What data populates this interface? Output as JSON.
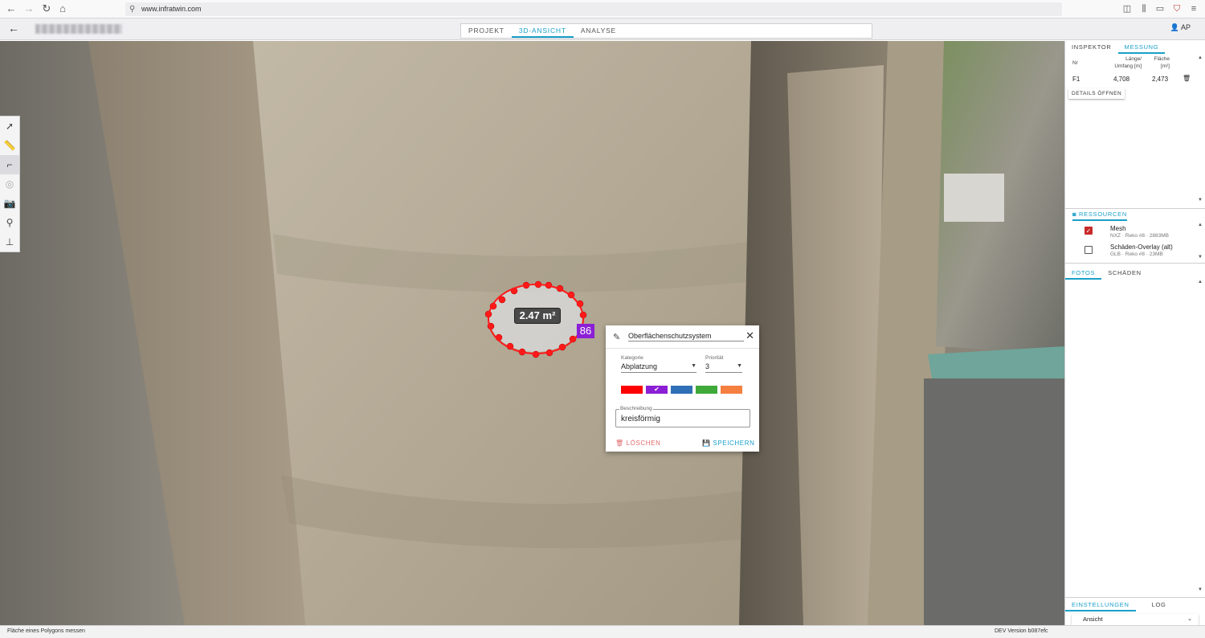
{
  "browser": {
    "url": "www.infratwin.com"
  },
  "header": {
    "tabs": [
      "PROJEKT",
      "3D-ANSICHT",
      "ANALYSE"
    ],
    "active_tab": "3D-ANSICHT",
    "user_initials": "AP"
  },
  "viewport": {
    "area_label": "2.47 m²",
    "point_badge": "86"
  },
  "dialog": {
    "title": "Oberflächenschutzsystem",
    "kategorie_label": "Kategorie",
    "kategorie_value": "Abplatzung",
    "prioritaet_label": "Priorität",
    "prioritaet_value": "3",
    "colors": [
      "#ff0000",
      "#8b1fd6",
      "#2f6fb5",
      "#3fa93a",
      "#f47f3f"
    ],
    "selected_color": "#8b1fd6",
    "beschreibung_label": "Beschreibung",
    "beschreibung_value": "kreisförmig",
    "delete_label": "LÖSCHEN",
    "save_label": "SPEICHERN"
  },
  "right_panel": {
    "tabs": [
      "INSPEKTOR",
      "MESSUNG"
    ],
    "measurement": {
      "col_nr": "Nr",
      "col_length_1": "Länge/",
      "col_length_2": "Umfang [m]",
      "col_area_1": "Fläche",
      "col_area_2": "[m²]",
      "rows": [
        {
          "nr": "F1",
          "length": "4,708",
          "area": "2,473"
        }
      ],
      "details_button": "DETAILS ÖFFNEN"
    },
    "resources": {
      "title": "RESSOURCEN",
      "items": [
        {
          "name": "Mesh",
          "meta": "NXZ · Reko #8 · 2883MB",
          "checked": true
        },
        {
          "name": "Schäden-Overlay (alt)",
          "meta": "GLB · Reko #8 · 23MB",
          "checked": false
        }
      ]
    },
    "media_tabs": [
      "FOTOS",
      "SCHÄDEN"
    ],
    "bottom_tabs": [
      "EINSTELLUNGEN",
      "LOG"
    ],
    "bottom_item": "Ansicht"
  },
  "status": {
    "left": "Fläche eines Polygons messen",
    "right": "DEV Version b087efc"
  }
}
